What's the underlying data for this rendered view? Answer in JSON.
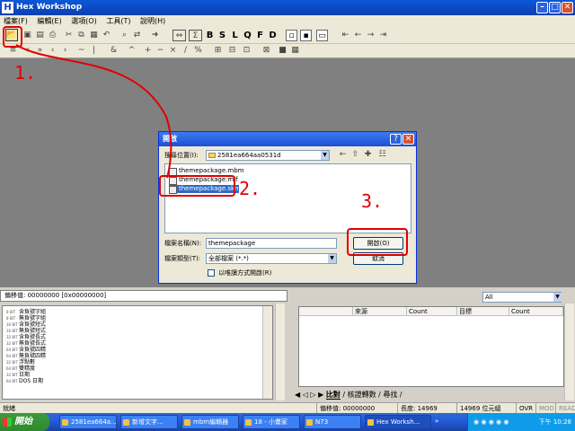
{
  "app": {
    "title": "Hex Workshop",
    "icon_letter": "H"
  },
  "menu": [
    "檔案(F)",
    "編輯(E)",
    "選項(O)",
    "工具(T)",
    "說明(H)"
  ],
  "toolbar_letters": [
    "B",
    "S",
    "L",
    "Q",
    "F",
    "D"
  ],
  "annotations": [
    "1.",
    "2.",
    "3."
  ],
  "dialog": {
    "title": "開啟",
    "lookin_label": "搜尋位置(I):",
    "lookin_value": "2581ea664aa0531d",
    "files": [
      "themepackage.mbm",
      "themepackage.mif",
      "themepackage.skn"
    ],
    "selected_index": 2,
    "filename_label": "檔案名稱(N):",
    "filename_value": "themepackage",
    "filetype_label": "檔案類型(T):",
    "filetype_value": "全部檔案 (*.*)",
    "open_button": "開啟(O)",
    "cancel_button": "取消",
    "readonly_label": "以唯讀方式開啟(R)"
  },
  "left_panel": {
    "offset_label": "偏移值: 00000000  [0x00000000]",
    "rows": [
      {
        "tag": "8 BIT",
        "label": "含負號字組"
      },
      {
        "tag": "8 BIT",
        "label": "無負號字組"
      },
      {
        "tag": "16 BIT",
        "label": "含負號短式"
      },
      {
        "tag": "16 BIT",
        "label": "無負號短式"
      },
      {
        "tag": "32 BIT",
        "label": "含負號長式"
      },
      {
        "tag": "32 BIT",
        "label": "無負號長式"
      },
      {
        "tag": "64 BIT",
        "label": "含負號四精"
      },
      {
        "tag": "64 BIT",
        "label": "無負號四精"
      },
      {
        "tag": "32 BIT",
        "label": "浮點數"
      },
      {
        "tag": "64 BIT",
        "label": "雙精度"
      },
      {
        "tag": "32 BIT",
        "label": "日期"
      },
      {
        "tag": "64 BIT",
        "label": "DOS 日期"
      }
    ]
  },
  "right_panel": {
    "filter_value": "All",
    "columns": [
      "來源",
      "Count",
      "目標",
      "Count"
    ],
    "tabs": [
      "比對",
      "核證轉數",
      "尋找"
    ]
  },
  "status": {
    "left": "就緒",
    "offset": "偏移值: 00000000",
    "length": "長度: 14969",
    "bytes": "14969 位元組",
    "ovr": "OVR",
    "mod": "MOD",
    "read": "READ"
  },
  "taskbar": {
    "start": "開始",
    "tasks": [
      "2581ea664a...",
      "新增文字...",
      "mbm編輯器",
      "18 - 小畫家",
      "N73",
      "Hex Worksh..."
    ],
    "active_task": 5,
    "clock": "下午 10:28"
  },
  "colors": {
    "annotation": "#e00000",
    "title_blue": "#0a58d8",
    "selection": "#316ac5"
  }
}
